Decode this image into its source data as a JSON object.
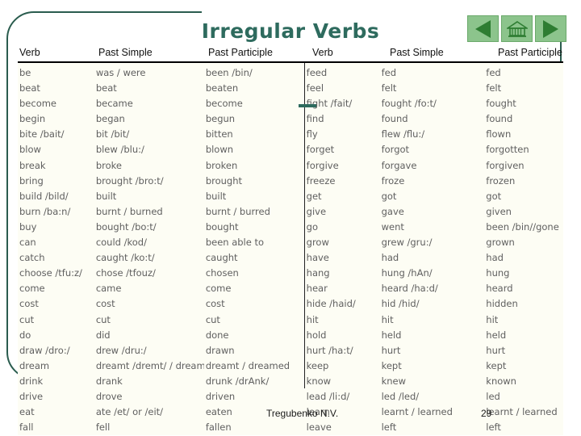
{
  "slide": {
    "title": "Irregular Verbs",
    "accent_color": "#2e6b5e",
    "nav_button_color": "#8cc48c",
    "table_background": "#fdfdf4"
  },
  "nav": {
    "back_icon": "triangle-left-icon",
    "home_icon": "home-icon",
    "forward_icon": "triangle-right-icon"
  },
  "table": {
    "headers_left": [
      "Verb",
      "Past Simple",
      "Past Participle"
    ],
    "headers_right": [
      "Verb",
      "Past Simple",
      "Past Participle"
    ],
    "left_rows": [
      [
        "be",
        "was / were",
        "been /bin/"
      ],
      [
        "beat",
        "beat",
        "beaten"
      ],
      [
        "become",
        "became",
        "become"
      ],
      [
        "begin",
        "began",
        "begun"
      ],
      [
        "bite /bait/",
        "bit /bit/",
        "bitten"
      ],
      [
        "blow",
        "blew /blu:/",
        "blown"
      ],
      [
        "break",
        "broke",
        "broken"
      ],
      [
        "bring",
        "brought /bro:t/",
        "brought"
      ],
      [
        "build /bild/",
        "built",
        "built"
      ],
      [
        "burn /ba:n/",
        "burnt / burned",
        "burnt / burred"
      ],
      [
        "buy",
        "bought /bo:t/",
        "bought"
      ],
      [
        "can",
        "could /kod/",
        "been able to"
      ],
      [
        "catch",
        "caught /ko:t/",
        "caught"
      ],
      [
        "choose /tfu:z/",
        "chose /tfouz/",
        "chosen"
      ],
      [
        "come",
        "came",
        "come"
      ],
      [
        "cost",
        "cost",
        "cost"
      ],
      [
        "cut",
        "cut",
        "cut"
      ],
      [
        "do",
        "did",
        "done"
      ],
      [
        "draw /dro:/",
        "drew /dru:/",
        "drawn"
      ],
      [
        "dream",
        "dreamt /dremt/ / dreamed",
        "dreamt / dreamed"
      ],
      [
        "drink",
        "drank",
        "drunk /drAnk/"
      ],
      [
        "drive",
        "drove",
        "driven"
      ],
      [
        "eat",
        "ate /et/ or /eit/",
        "eaten"
      ],
      [
        "fall",
        "fell",
        "fallen"
      ]
    ],
    "right_rows": [
      [
        "feed",
        "fed",
        "fed"
      ],
      [
        "feel",
        "felt",
        "felt"
      ],
      [
        "fight /fait/",
        "fought /fo:t/",
        "fought"
      ],
      [
        "find",
        "found",
        "found"
      ],
      [
        "fly",
        "flew /flu:/",
        "flown"
      ],
      [
        "forget",
        "forgot",
        "forgotten"
      ],
      [
        "forgive",
        "forgave",
        "forgiven"
      ],
      [
        "freeze",
        "froze",
        "frozen"
      ],
      [
        "get",
        "got",
        "got"
      ],
      [
        "give",
        "gave",
        "given"
      ],
      [
        "go",
        "went",
        "been /bin//gone"
      ],
      [
        "grow",
        "grew /gru:/",
        "grown"
      ],
      [
        "have",
        "had",
        "had"
      ],
      [
        "hang",
        "hung /hAn/",
        "hung"
      ],
      [
        "hear",
        "heard /ha:d/",
        "heard"
      ],
      [
        "hide /haid/",
        "hid /hid/",
        "hidden"
      ],
      [
        "hit",
        "hit",
        "hit"
      ],
      [
        "hold",
        "held",
        "held"
      ],
      [
        "hurt /ha:t/",
        "hurt",
        "hurt"
      ],
      [
        "keep",
        "kept",
        "kept"
      ],
      [
        "know",
        "knew",
        "known"
      ],
      [
        "lead /li:d/",
        "led /led/",
        "led"
      ],
      [
        "learn",
        "learnt / learned",
        "learnt / learned"
      ],
      [
        "leave",
        "left",
        "left"
      ]
    ]
  },
  "footer": {
    "author": "Tregubenko N.V.",
    "page_number": "29"
  }
}
